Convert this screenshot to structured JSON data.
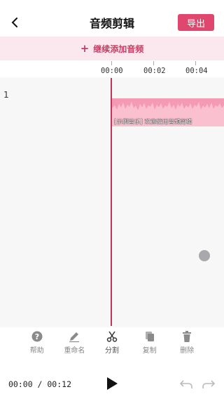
{
  "header": {
    "title": "音频剪辑",
    "export_label": "导出"
  },
  "add_bar": {
    "label": "继续添加音频"
  },
  "ruler": {
    "marks": [
      "00:00",
      "00:02",
      "00:04"
    ]
  },
  "track": {
    "number": "1",
    "clip_label": "[示例音乐] 欢迎使用音频剪辑"
  },
  "toolbar": {
    "items": [
      {
        "label": "帮助",
        "icon": "help-icon"
      },
      {
        "label": "重命名",
        "icon": "pencil-icon"
      },
      {
        "label": "分割",
        "icon": "scissors-icon"
      },
      {
        "label": "复制",
        "icon": "copy-icon"
      },
      {
        "label": "删除",
        "icon": "trash-icon"
      }
    ]
  },
  "player": {
    "time": "00:00 / 00:12"
  },
  "colors": {
    "accent": "#e0476e",
    "clip": "#f59ab4",
    "playhead": "#c2355b",
    "add_bar_bg": "#fbe7ee"
  }
}
